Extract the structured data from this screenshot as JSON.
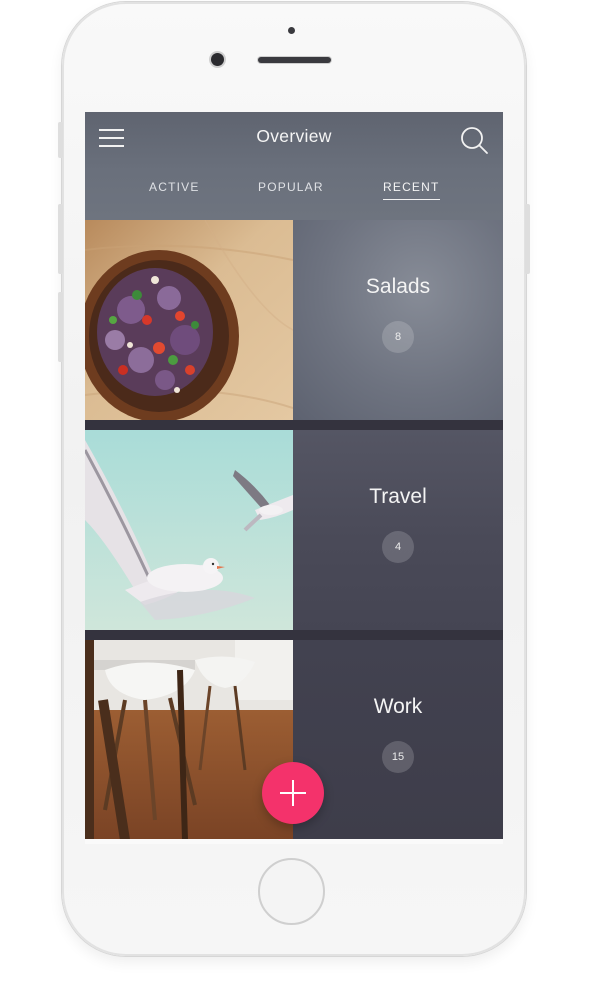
{
  "header": {
    "title": "Overview",
    "menu_icon": "hamburger-menu-icon",
    "search_icon": "search-icon"
  },
  "tabs": [
    {
      "label": "ACTIVE",
      "selected": false
    },
    {
      "label": "POPULAR",
      "selected": false
    },
    {
      "label": "RECENT",
      "selected": true
    }
  ],
  "categories": [
    {
      "name": "Salads",
      "count": "8",
      "image": "salad-bowl-photo"
    },
    {
      "name": "Travel",
      "count": "4",
      "image": "seagulls-sky-photo"
    },
    {
      "name": "Work",
      "count": "15",
      "image": "office-chairs-photo"
    }
  ],
  "fab": {
    "icon": "plus-icon"
  },
  "colors": {
    "accent": "#F4326B",
    "header_bg": "#666C78",
    "panel_dark": "#3F3E4A"
  }
}
